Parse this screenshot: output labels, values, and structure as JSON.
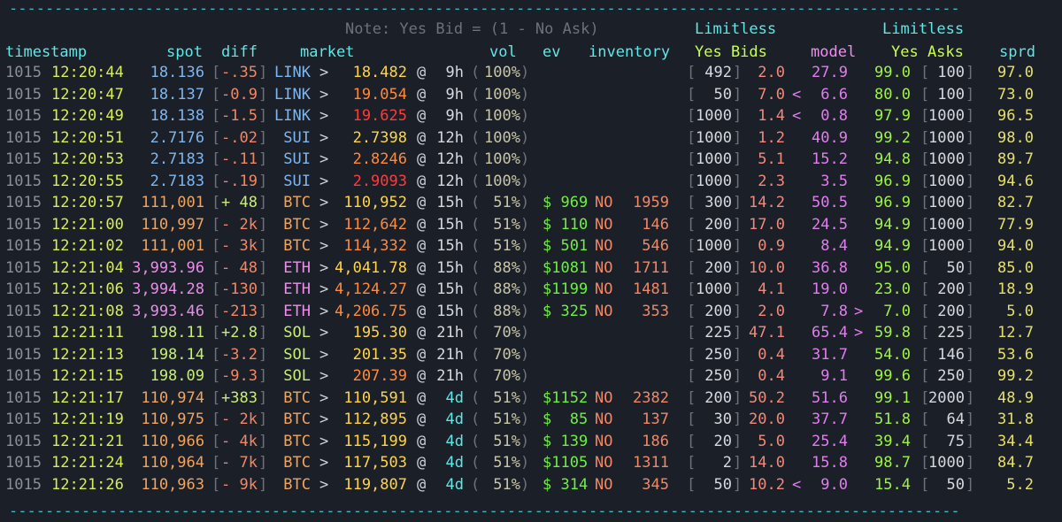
{
  "header": {
    "note": "Note: Yes Bid = (1 - No Ask)",
    "limitless_bids_line1": "Limitless",
    "limitless_bids_line2": "Yes Bids",
    "limitless_asks_line1": "Limitless",
    "limitless_asks_line2": "Yes Asks",
    "columns": {
      "timestamp": "timestamp",
      "spot": "spot",
      "diff": "diff",
      "market": "market",
      "vol": "vol",
      "ev": "ev",
      "inventory": "inventory",
      "model": "model",
      "sprd": "sprd"
    }
  },
  "colors": {
    "background": "#1b1f27",
    "date": "#8a9099",
    "time": "#d8ee55",
    "spot_link": "#7fb6ee",
    "spot_btc": "#f0a45e",
    "spot_eth": "#e58fe6",
    "spot_sol": "#c8ec7a",
    "market_label": "#5ee8e6",
    "eth_label": "#ee8fee",
    "strike_low": "#ffd447",
    "strike_mid": "#ff8a3c",
    "strike_high": "#ff3b3b",
    "ev": "#6ef040",
    "inventory": "#f08868",
    "bid_price": "#f08a7c",
    "model": "#e27df0",
    "ask_price": "#9ff248",
    "sprd": "#e4e06a"
  },
  "rows": [
    {
      "date": "1015",
      "time": "12:20:44",
      "spot": "18.136",
      "diff": "-.35",
      "asset": "LINK",
      "strike": "18.482",
      "strike_level": "low",
      "expiry": "9h",
      "vol": "100%",
      "ev": "",
      "ev_side": "",
      "inventory": "",
      "bid_size": "492",
      "bid": "2.0",
      "marker_left": "",
      "model": "27.9",
      "marker_right": "",
      "ask": "99.0",
      "ask_size": "100",
      "sprd": "97.0"
    },
    {
      "date": "1015",
      "time": "12:20:47",
      "spot": "18.137",
      "diff": "-0.9",
      "asset": "LINK",
      "strike": "19.054",
      "strike_level": "mid",
      "expiry": "9h",
      "vol": "100%",
      "ev": "",
      "ev_side": "",
      "inventory": "",
      "bid_size": "50",
      "bid": "7.0",
      "marker_left": "<",
      "model": "6.6",
      "marker_right": "",
      "ask": "80.0",
      "ask_size": "100",
      "sprd": "73.0"
    },
    {
      "date": "1015",
      "time": "12:20:49",
      "spot": "18.138",
      "diff": "-1.5",
      "asset": "LINK",
      "strike": "19.625",
      "strike_level": "high",
      "expiry": "9h",
      "vol": "100%",
      "ev": "",
      "ev_side": "",
      "inventory": "",
      "bid_size": "1000",
      "bid": "1.4",
      "marker_left": "<",
      "model": "0.8",
      "marker_right": "",
      "ask": "97.9",
      "ask_size": "1000",
      "sprd": "96.5"
    },
    {
      "date": "1015",
      "time": "12:20:51",
      "spot": "2.7176",
      "diff": "-.02",
      "asset": "SUI",
      "strike": "2.7398",
      "strike_level": "low",
      "expiry": "12h",
      "vol": "100%",
      "ev": "",
      "ev_side": "",
      "inventory": "",
      "bid_size": "1000",
      "bid": "1.2",
      "marker_left": "",
      "model": "40.9",
      "marker_right": "",
      "ask": "99.2",
      "ask_size": "1000",
      "sprd": "98.0"
    },
    {
      "date": "1015",
      "time": "12:20:53",
      "spot": "2.7183",
      "diff": "-.11",
      "asset": "SUI",
      "strike": "2.8246",
      "strike_level": "mid",
      "expiry": "12h",
      "vol": "100%",
      "ev": "",
      "ev_side": "",
      "inventory": "",
      "bid_size": "1000",
      "bid": "5.1",
      "marker_left": "",
      "model": "15.2",
      "marker_right": "",
      "ask": "94.8",
      "ask_size": "1000",
      "sprd": "89.7"
    },
    {
      "date": "1015",
      "time": "12:20:55",
      "spot": "2.7183",
      "diff": "-.19",
      "asset": "SUI",
      "strike": "2.9093",
      "strike_level": "high",
      "expiry": "12h",
      "vol": "100%",
      "ev": "",
      "ev_side": "",
      "inventory": "",
      "bid_size": "1000",
      "bid": "2.3",
      "marker_left": "",
      "model": "3.5",
      "marker_right": "",
      "ask": "96.9",
      "ask_size": "1000",
      "sprd": "94.6"
    },
    {
      "date": "1015",
      "time": "12:20:57",
      "spot": "111,001",
      "diff": "+ 48",
      "asset": "BTC",
      "strike": "110,952",
      "strike_level": "low",
      "expiry": "15h",
      "vol": " 51%",
      "ev": "$ 969",
      "ev_side": "NO",
      "inventory": "1959",
      "bid_size": "300",
      "bid": "14.2",
      "marker_left": "",
      "model": "50.5",
      "marker_right": "",
      "ask": "96.9",
      "ask_size": "1000",
      "sprd": "82.7"
    },
    {
      "date": "1015",
      "time": "12:21:00",
      "spot": "110,997",
      "diff": "- 2k",
      "asset": "BTC",
      "strike": "112,642",
      "strike_level": "mid",
      "expiry": "15h",
      "vol": " 51%",
      "ev": "$ 110",
      "ev_side": "NO",
      "inventory": "146",
      "bid_size": "200",
      "bid": "17.0",
      "marker_left": "",
      "model": "24.5",
      "marker_right": "",
      "ask": "94.9",
      "ask_size": "1000",
      "sprd": "77.9"
    },
    {
      "date": "1015",
      "time": "12:21:02",
      "spot": "111,001",
      "diff": "- 3k",
      "asset": "BTC",
      "strike": "114,332",
      "strike_level": "mid",
      "expiry": "15h",
      "vol": " 51%",
      "ev": "$ 501",
      "ev_side": "NO",
      "inventory": "546",
      "bid_size": "1000",
      "bid": "0.9",
      "marker_left": "",
      "model": "8.4",
      "marker_right": "",
      "ask": "94.9",
      "ask_size": "1000",
      "sprd": "94.0"
    },
    {
      "date": "1015",
      "time": "12:21:04",
      "spot": "3,993.96",
      "diff": "- 48",
      "asset": "ETH",
      "strike": "4,041.78",
      "strike_level": "low",
      "expiry": "15h",
      "vol": " 88%",
      "ev": "$1081",
      "ev_side": "NO",
      "inventory": "1711",
      "bid_size": "200",
      "bid": "10.0",
      "marker_left": "",
      "model": "36.8",
      "marker_right": "",
      "ask": "95.0",
      "ask_size": "50",
      "sprd": "85.0"
    },
    {
      "date": "1015",
      "time": "12:21:06",
      "spot": "3,994.28",
      "diff": "-130",
      "asset": "ETH",
      "strike": "4,124.27",
      "strike_level": "mid",
      "expiry": "15h",
      "vol": " 88%",
      "ev": "$1199",
      "ev_side": "NO",
      "inventory": "1481",
      "bid_size": "1000",
      "bid": "4.1",
      "marker_left": "",
      "model": "19.0",
      "marker_right": "",
      "ask": "23.0",
      "ask_size": "200",
      "sprd": "18.9"
    },
    {
      "date": "1015",
      "time": "12:21:08",
      "spot": "3,993.46",
      "diff": "-213",
      "asset": "ETH",
      "strike": "4,206.75",
      "strike_level": "mid",
      "expiry": "15h",
      "vol": " 88%",
      "ev": "$ 325",
      "ev_side": "NO",
      "inventory": "353",
      "bid_size": "200",
      "bid": "2.0",
      "marker_left": "",
      "model": "7.8",
      "marker_right": ">",
      "ask": "7.0",
      "ask_size": "200",
      "sprd": "5.0"
    },
    {
      "date": "1015",
      "time": "12:21:11",
      "spot": "198.11",
      "diff": "+2.8",
      "asset": "SOL",
      "strike": "195.30",
      "strike_level": "low",
      "expiry": "21h",
      "vol": " 70%",
      "ev": "",
      "ev_side": "",
      "inventory": "",
      "bid_size": "225",
      "bid": "47.1",
      "marker_left": "",
      "model": "65.4",
      "marker_right": ">",
      "ask": "59.8",
      "ask_size": "225",
      "sprd": "12.7"
    },
    {
      "date": "1015",
      "time": "12:21:13",
      "spot": "198.14",
      "diff": "-3.2",
      "asset": "SOL",
      "strike": "201.35",
      "strike_level": "low",
      "expiry": "21h",
      "vol": " 70%",
      "ev": "",
      "ev_side": "",
      "inventory": "",
      "bid_size": "250",
      "bid": "0.4",
      "marker_left": "",
      "model": "31.7",
      "marker_right": "",
      "ask": "54.0",
      "ask_size": "146",
      "sprd": "53.6"
    },
    {
      "date": "1015",
      "time": "12:21:15",
      "spot": "198.09",
      "diff": "-9.3",
      "asset": "SOL",
      "strike": "207.39",
      "strike_level": "mid",
      "expiry": "21h",
      "vol": " 70%",
      "ev": "",
      "ev_side": "",
      "inventory": "",
      "bid_size": "250",
      "bid": "0.4",
      "marker_left": "",
      "model": "9.1",
      "marker_right": "",
      "ask": "99.6",
      "ask_size": "250",
      "sprd": "99.2"
    },
    {
      "date": "1015",
      "time": "12:21:17",
      "spot": "110,974",
      "diff": "+383",
      "asset": "BTC",
      "strike": "110,591",
      "strike_level": "low",
      "expiry": "4d",
      "vol": " 51%",
      "ev": "$1152",
      "ev_side": "NO",
      "inventory": "2382",
      "bid_size": "200",
      "bid": "50.2",
      "marker_left": "",
      "model": "51.6",
      "marker_right": "",
      "ask": "99.1",
      "ask_size": "2000",
      "sprd": "48.9"
    },
    {
      "date": "1015",
      "time": "12:21:19",
      "spot": "110,975",
      "diff": "- 2k",
      "asset": "BTC",
      "strike": "112,895",
      "strike_level": "low",
      "expiry": "4d",
      "vol": " 51%",
      "ev": "$  85",
      "ev_side": "NO",
      "inventory": "137",
      "bid_size": "30",
      "bid": "20.0",
      "marker_left": "",
      "model": "37.7",
      "marker_right": "",
      "ask": "51.8",
      "ask_size": "64",
      "sprd": "31.8"
    },
    {
      "date": "1015",
      "time": "12:21:21",
      "spot": "110,966",
      "diff": "- 4k",
      "asset": "BTC",
      "strike": "115,199",
      "strike_level": "low",
      "expiry": "4d",
      "vol": " 51%",
      "ev": "$ 139",
      "ev_side": "NO",
      "inventory": "186",
      "bid_size": "20",
      "bid": "5.0",
      "marker_left": "",
      "model": "25.4",
      "marker_right": "",
      "ask": "39.4",
      "ask_size": "75",
      "sprd": "34.4"
    },
    {
      "date": "1015",
      "time": "12:21:24",
      "spot": "110,964",
      "diff": "- 7k",
      "asset": "BTC",
      "strike": "117,503",
      "strike_level": "low",
      "expiry": "4d",
      "vol": " 51%",
      "ev": "$1105",
      "ev_side": "NO",
      "inventory": "1311",
      "bid_size": "2",
      "bid": "14.0",
      "marker_left": "",
      "model": "15.8",
      "marker_right": "",
      "ask": "98.7",
      "ask_size": "1000",
      "sprd": "84.7"
    },
    {
      "date": "1015",
      "time": "12:21:26",
      "spot": "110,963",
      "diff": "- 9k",
      "asset": "BTC",
      "strike": "119,807",
      "strike_level": "low",
      "expiry": "4d",
      "vol": " 51%",
      "ev": "$ 314",
      "ev_side": "NO",
      "inventory": "345",
      "bid_size": "50",
      "bid": "10.2",
      "marker_left": "<",
      "model": "9.0",
      "marker_right": "",
      "ask": "15.4",
      "ask_size": "50",
      "sprd": "5.2"
    }
  ]
}
